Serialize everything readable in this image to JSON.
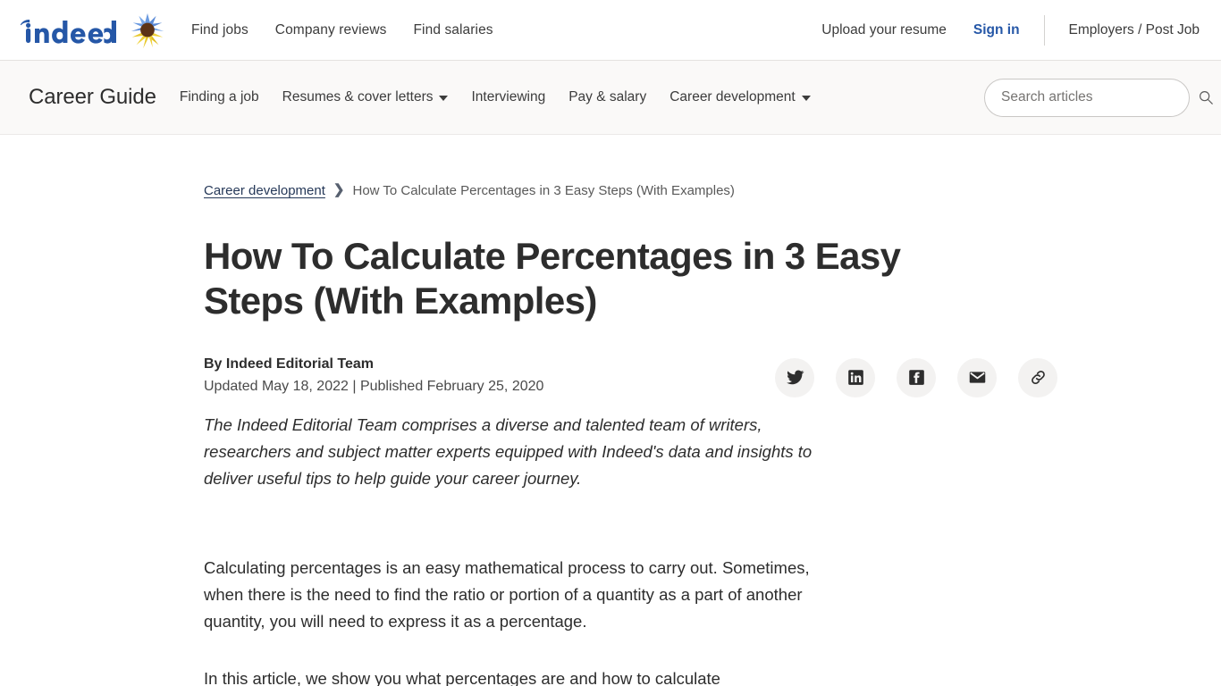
{
  "header": {
    "logo_text": "indeed",
    "logo_icon": "indeed-sunflower-logo",
    "nav": [
      {
        "label": "Find jobs"
      },
      {
        "label": "Company reviews"
      },
      {
        "label": "Find salaries"
      }
    ],
    "upload_resume": "Upload your resume",
    "sign_in": "Sign in",
    "employers": "Employers / Post Job",
    "sign_in_color": "#2557a7"
  },
  "guide_bar": {
    "title": "Career Guide",
    "nav": [
      {
        "label": "Finding a job",
        "has_dropdown": false
      },
      {
        "label": "Resumes & cover letters",
        "has_dropdown": true
      },
      {
        "label": "Interviewing",
        "has_dropdown": false
      },
      {
        "label": "Pay & salary",
        "has_dropdown": false
      },
      {
        "label": "Career development",
        "has_dropdown": true
      }
    ],
    "search": {
      "placeholder": "Search articles",
      "value": "",
      "icon": "search-icon"
    },
    "background_color": "#faf9f8"
  },
  "article": {
    "breadcrumb": {
      "parent": "Career development",
      "separator": "›",
      "current": "How To Calculate Percentages in 3 Easy Steps (With Examples)"
    },
    "title": "How To Calculate Percentages in 3 Easy Steps (With Examples)",
    "byline": "By Indeed Editorial Team",
    "dateline": "Updated May 18, 2022 | Published February 25, 2020",
    "share_buttons": [
      {
        "name": "twitter",
        "label": "Share on Twitter"
      },
      {
        "name": "linkedin",
        "label": "Share on LinkedIn"
      },
      {
        "name": "facebook",
        "label": "Share on Facebook"
      },
      {
        "name": "email",
        "label": "Share by email"
      },
      {
        "name": "link",
        "label": "Copy link"
      }
    ],
    "editorial_note": "The Indeed Editorial Team comprises a diverse and talented team of writers, researchers and subject matter experts equipped with Indeed's data and insights to deliver useful tips to help guide your career journey.",
    "paragraphs": [
      "Calculating percentages is an easy mathematical process to carry out. Sometimes, when there is the need to find the ratio or portion of a quantity as a part of another quantity, you will need to express it as a percentage.",
      "In this article, we show you what percentages are and how to calculate"
    ]
  }
}
